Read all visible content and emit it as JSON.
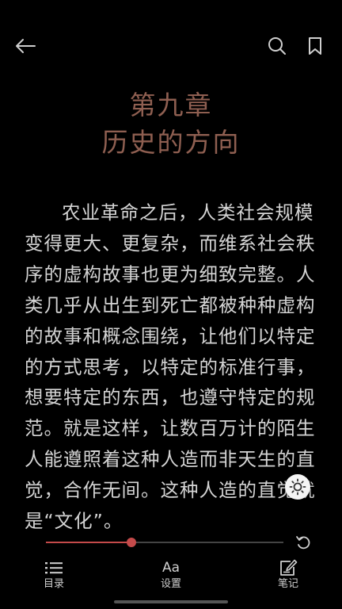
{
  "chapter": {
    "number": "第九章",
    "title": "历史的方向"
  },
  "body_text": "农业革命之后，人类社会规模变得更大、更复杂，而维系社会秩序的虚构故事也更为细致完整。人类几乎从出生到死亡都被种种虚构的故事和概念围绕，让他们以特定的方式思考，以特定的标准行事，想要特定的东西，也遵守特定的规范。就是这样，让数百万计的陌生人能遵照着这种人造而非天生的直觉，合作无间。这种人造的直觉就是“文化”。",
  "progress": 0.36,
  "colors": {
    "background": "#000000",
    "chapter_title": "#8f5f51",
    "accent": "#c44a4a",
    "text": "#d4d4d4"
  },
  "icons": {
    "back": "back-arrow-icon",
    "search": "search-icon",
    "bookmark": "bookmark-icon",
    "brightness": "brightness-icon",
    "undo": "undo-icon",
    "toc": "list-icon",
    "settings": "text-size-icon",
    "notes": "note-edit-icon"
  },
  "bottom_nav": {
    "toc": "目录",
    "settings_icon_text": "Aa",
    "settings": "设置",
    "notes": "笔记"
  }
}
